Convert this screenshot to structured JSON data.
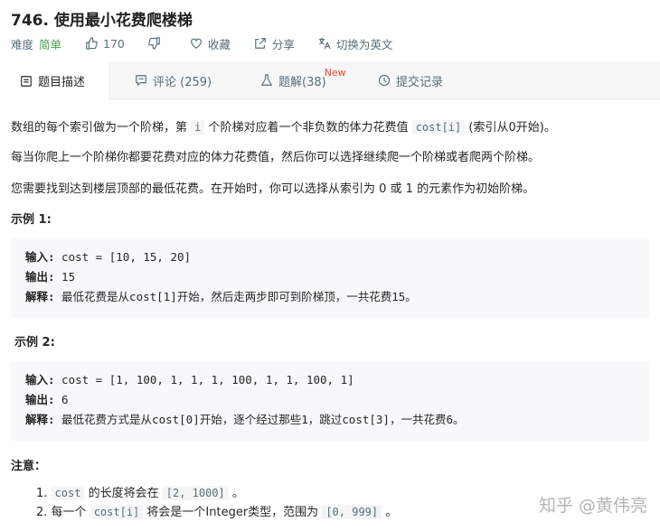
{
  "problem": {
    "title": "746. 使用最小花费爬楼梯",
    "difficulty_label": "难度",
    "difficulty_value": "简单",
    "like_count": "170",
    "favorite_label": "收藏",
    "share_label": "分享",
    "translate_label": "切换为英文"
  },
  "tabs": [
    {
      "label": "题目描述"
    },
    {
      "label": "评论 (259)"
    },
    {
      "label": "题解(38)",
      "badge": "New"
    },
    {
      "label": "提交记录"
    }
  ],
  "description": {
    "p1_before": "数组的每个索引做为一个阶梯，第",
    "p1_code1": "i",
    "p1_middle": "个阶梯对应着一个非负数的体力花费值",
    "p1_code2": "cost[i]",
    "p1_after": "(索引从0开始)。",
    "p2": "每当你爬上一个阶梯你都要花费对应的体力花费值，然后你可以选择继续爬一个阶梯或者爬两个阶梯。",
    "p3": "您需要找到达到楼层顶部的最低花费。在开始时，你可以选择从索引为 0 或 1 的元素作为初始阶梯。"
  },
  "examples": [
    {
      "heading": "示例 1:",
      "input_label": "输入:",
      "input_value": " cost = [10, 15, 20]",
      "output_label": "输出:",
      "output_value": " 15",
      "explain_label": "解释:",
      "explain_value": " 最低花费是从cost[1]开始，然后走两步即可到阶梯顶，一共花费15。"
    },
    {
      "heading": "示例 2:",
      "input_label": "输入:",
      "input_value": " cost = [1, 100, 1, 1, 1, 100, 1, 1, 100, 1]",
      "output_label": "输出:",
      "output_value": " 6",
      "explain_label": "解释:",
      "explain_value": " 最低花费方式是从cost[0]开始，逐个经过那些1，跳过cost[3]，一共花费6。"
    }
  ],
  "notes": {
    "heading": "注意：",
    "item1_num": "1.",
    "item1_code": "cost",
    "item1_mid": "的长度将会在",
    "item1_code2": "[2, 1000]",
    "item1_end": "。",
    "item2_num": "2.",
    "item2_pre": "每一个",
    "item2_code": "cost[i]",
    "item2_mid": "将会是一个Integer类型，范围为",
    "item2_code2": "[0, 999]",
    "item2_end": "。"
  },
  "watermark": "知乎 @黄伟亮",
  "colors": {
    "easy": "#43a047",
    "new_badge": "#f44336",
    "meta_text": "#546e7a",
    "tab_bar": "#f7f7f7",
    "example_bg": "#f7f8fa"
  },
  "icons": {
    "like": "thumb-up-icon",
    "dislike": "thumb-down-icon",
    "favorite": "heart-icon",
    "share": "share-icon",
    "translate": "translate-icon",
    "tab_description": "document-icon",
    "tab_comments": "comment-icon",
    "tab_solutions": "flask-icon",
    "tab_submissions": "clock-icon"
  }
}
